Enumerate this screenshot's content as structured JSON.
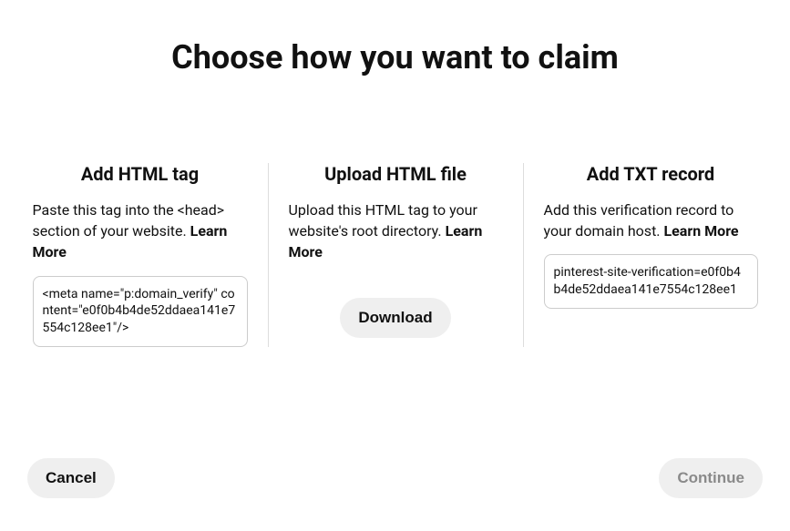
{
  "heading": "Choose how you want to claim",
  "options": {
    "html_tag": {
      "title": "Add HTML tag",
      "description": "Paste this tag into the <head> section of your website.",
      "learn_more": "Learn More",
      "code": "<meta name=\"p:domain_verify\" content=\"e0f0b4b4de52ddaea141e7554c128ee1\"/>"
    },
    "upload": {
      "title": "Upload HTML file",
      "description": "Upload this HTML tag to your website's root directory.",
      "learn_more": "Learn More",
      "download_label": "Download"
    },
    "txt": {
      "title": "Add TXT record",
      "description": "Add this verification record to your domain host.",
      "learn_more": "Learn More",
      "code": "pinterest-site-verification=e0f0b4b4de52ddaea141e7554c128ee1"
    }
  },
  "footer": {
    "cancel_label": "Cancel",
    "continue_label": "Continue"
  }
}
